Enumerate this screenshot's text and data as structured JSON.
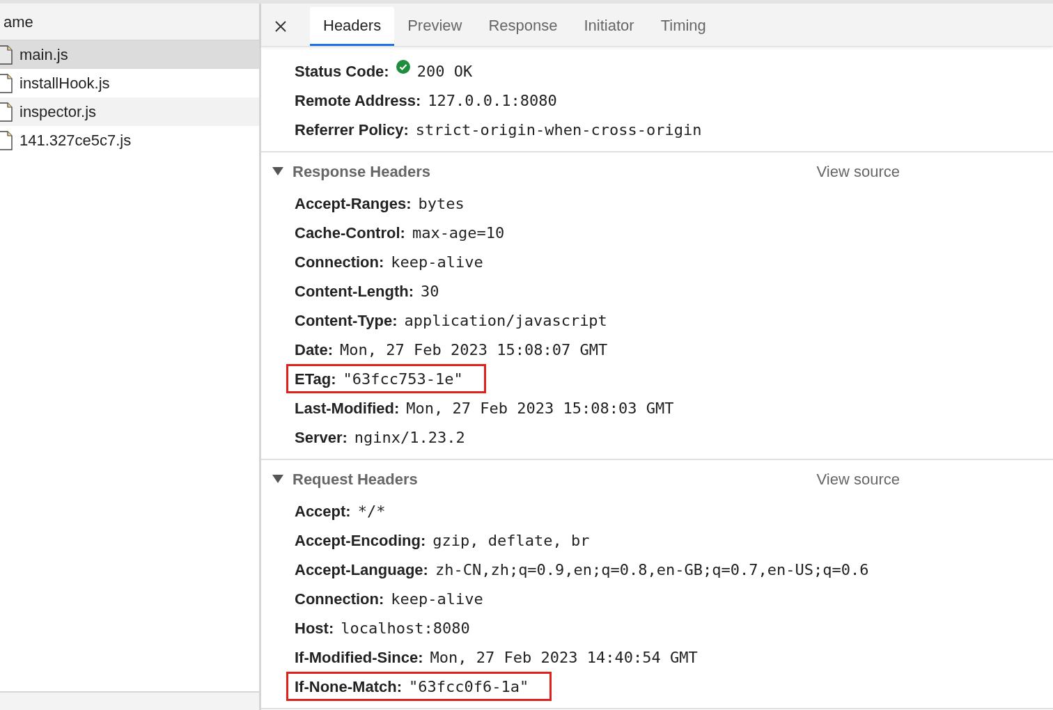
{
  "file_list": {
    "column_header": "ame",
    "files": [
      {
        "name": "main.js",
        "selected": true
      },
      {
        "name": "installHook.js",
        "selected": false
      },
      {
        "name": "inspector.js",
        "selected": false
      },
      {
        "name": "141.327ce5c7.js",
        "selected": false
      }
    ]
  },
  "tabs": [
    {
      "label": "Headers",
      "selected": true
    },
    {
      "label": "Preview",
      "selected": false
    },
    {
      "label": "Response",
      "selected": false
    },
    {
      "label": "Initiator",
      "selected": false
    },
    {
      "label": "Timing",
      "selected": false
    }
  ],
  "general": [
    {
      "name": "Status Code:",
      "value": "200 OK",
      "status_ok": true
    },
    {
      "name": "Remote Address:",
      "value": "127.0.0.1:8080"
    },
    {
      "name": "Referrer Policy:",
      "value": "strict-origin-when-cross-origin"
    }
  ],
  "sections": [
    {
      "title": "Response Headers",
      "expanded": true,
      "link": "View source",
      "headers": [
        {
          "name": "Accept-Ranges:",
          "value": "bytes",
          "highlighted": false
        },
        {
          "name": "Cache-Control:",
          "value": "max-age=10",
          "highlighted": false
        },
        {
          "name": "Connection:",
          "value": "keep-alive",
          "highlighted": false
        },
        {
          "name": "Content-Length:",
          "value": "30",
          "highlighted": false
        },
        {
          "name": "Content-Type:",
          "value": "application/javascript",
          "highlighted": false
        },
        {
          "name": "Date:",
          "value": "Mon, 27 Feb 2023 15:08:07 GMT",
          "highlighted": false
        },
        {
          "name": "ETag:",
          "value": "\"63fcc753-1e\"",
          "highlighted": true
        },
        {
          "name": "Last-Modified:",
          "value": "Mon, 27 Feb 2023 15:08:03 GMT",
          "highlighted": false
        },
        {
          "name": "Server:",
          "value": "nginx/1.23.2",
          "highlighted": false
        }
      ]
    },
    {
      "title": "Request Headers",
      "expanded": true,
      "link": "View source",
      "headers": [
        {
          "name": "Accept:",
          "value": "*/*",
          "highlighted": false
        },
        {
          "name": "Accept-Encoding:",
          "value": "gzip, deflate, br",
          "highlighted": false
        },
        {
          "name": "Accept-Language:",
          "value": "zh-CN,zh;q=0.9,en;q=0.8,en-GB;q=0.7,en-US;q=0.6",
          "highlighted": false
        },
        {
          "name": "Connection:",
          "value": "keep-alive",
          "highlighted": false
        },
        {
          "name": "Host:",
          "value": "localhost:8080",
          "highlighted": false
        },
        {
          "name": "If-Modified-Since:",
          "value": "Mon, 27 Feb 2023 14:40:54 GMT",
          "highlighted": false
        },
        {
          "name": "If-None-Match:",
          "value": "\"63fcc0f6-1a\"",
          "highlighted": true
        }
      ]
    }
  ]
}
